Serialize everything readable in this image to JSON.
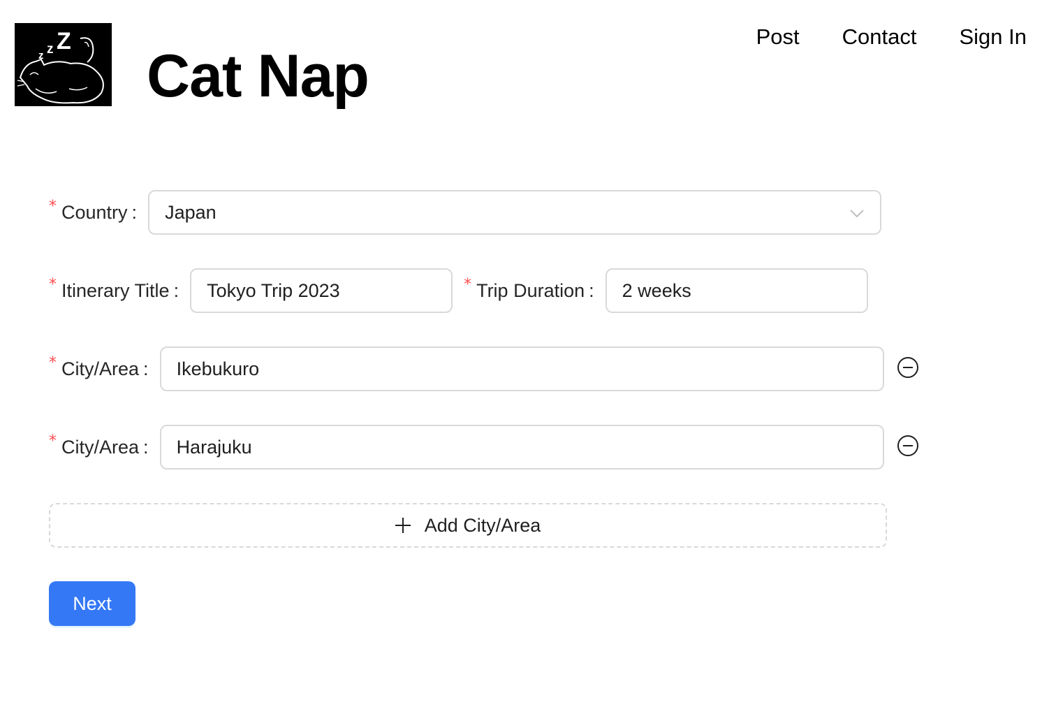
{
  "header": {
    "brand": "Cat Nap",
    "logo_icon": "sleeping-cat-icon",
    "nav": [
      "Post",
      "Contact",
      "Sign In"
    ]
  },
  "form": {
    "country": {
      "label": "Country",
      "value": "Japan",
      "options_selected": "Japan"
    },
    "itinerary_title": {
      "label": "Itinerary Title",
      "value": "Tokyo Trip 2023"
    },
    "trip_duration": {
      "label": "Trip Duration",
      "value": "2 weeks"
    },
    "cities": [
      {
        "label": "City/Area",
        "value": "Ikebukuro"
      },
      {
        "label": "City/Area",
        "value": "Harajuku"
      }
    ],
    "colon": ":",
    "required_mark": "*",
    "add_city_label": "Add City/Area",
    "next_label": "Next"
  },
  "colors": {
    "primary": "#3478f6",
    "required": "#ff4d4f",
    "border": "#d9d9d9"
  }
}
